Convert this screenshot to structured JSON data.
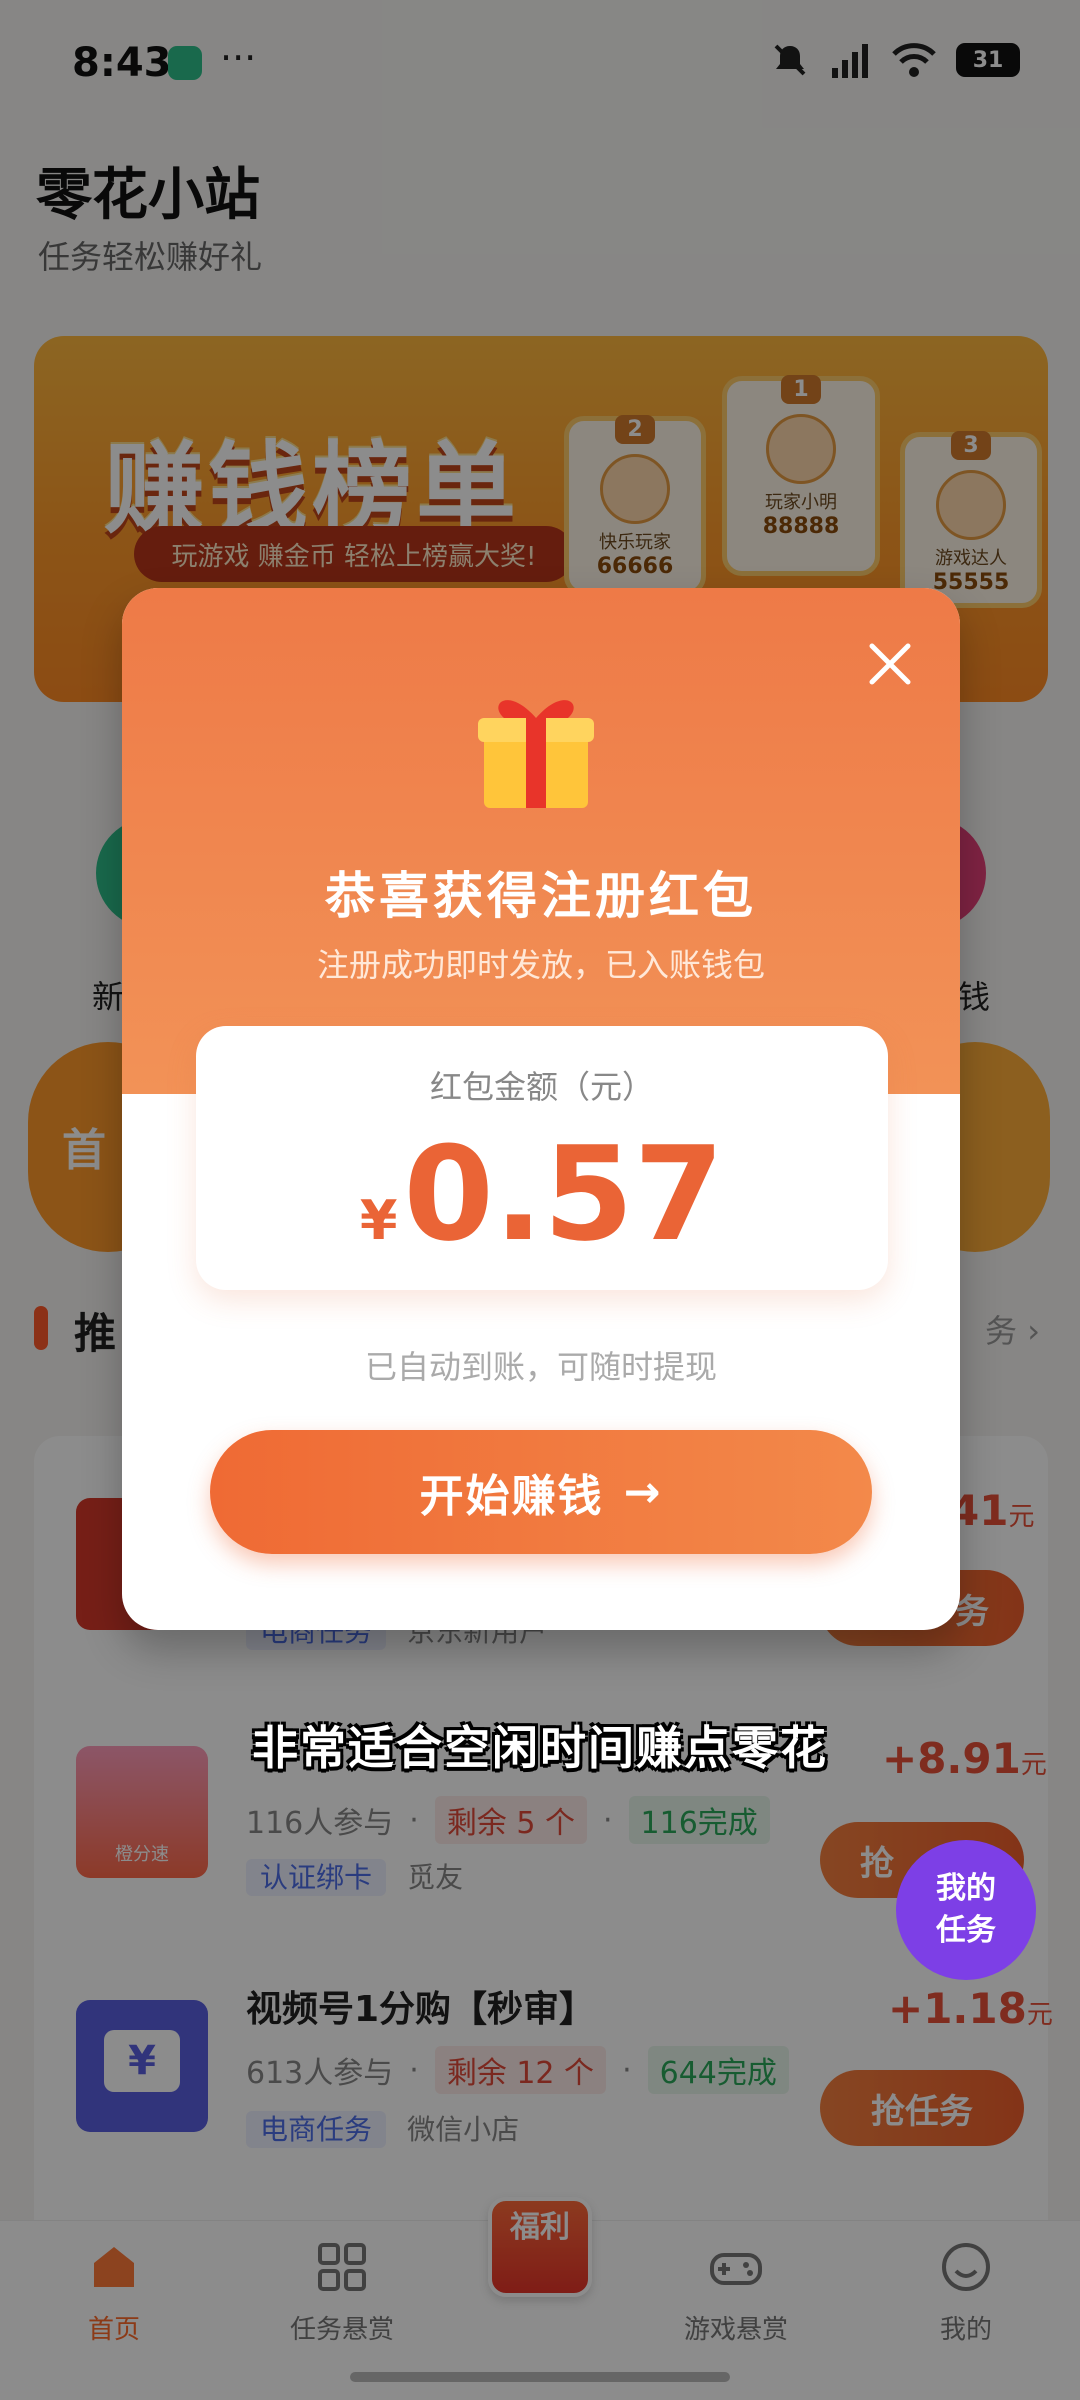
{
  "status_bar": {
    "time": "8:43",
    "more": "···",
    "battery": "31"
  },
  "header": {
    "title": "零花小站",
    "subtitle": "任务轻松赚好礼"
  },
  "banner": {
    "headline": "赚钱榜单",
    "slogan": "玩游戏 赚金币 轻松上榜赢大奖!",
    "leaders": [
      {
        "rank": "2",
        "name": "快乐玩家",
        "score": "66666"
      },
      {
        "rank": "1",
        "name": "玩家小明",
        "score": "88888"
      },
      {
        "rank": "3",
        "name": "游戏达人",
        "score": "55555"
      }
    ]
  },
  "shortcuts": {
    "left_label": "新",
    "right_label": "钱"
  },
  "promo": {
    "left_text": "首"
  },
  "section": {
    "title": "推",
    "more": "务"
  },
  "tasks": [
    {
      "reward": "41",
      "unit": "元",
      "grab": "务",
      "tag": "电商任务",
      "source": "京东新用户"
    },
    {
      "participants": "116人参与",
      "remaining": "剩余 5 个",
      "done": "116完成",
      "tag": "认证绑卡",
      "source": "觅友",
      "reward": "+8.91",
      "unit": "元",
      "grab": "抢",
      "thumb_label": "橙分速"
    },
    {
      "name": "视频号1分购【秒审】",
      "participants": "613人参与",
      "remaining": "剩余 12 个",
      "done": "644完成",
      "tag": "电商任务",
      "source": "微信小店",
      "reward": "+1.18",
      "unit": "元",
      "grab": "抢任务"
    }
  ],
  "floating": {
    "line1": "我的",
    "line2": "任务"
  },
  "tabbar": {
    "items": [
      {
        "label": "首页",
        "icon": "home-icon",
        "active": true
      },
      {
        "label": "任务悬赏",
        "icon": "grid-icon"
      },
      {
        "label": "福利",
        "icon": "gift-badge-icon"
      },
      {
        "label": "游戏悬赏",
        "icon": "gamepad-icon"
      },
      {
        "label": "我的",
        "icon": "smile-icon"
      }
    ]
  },
  "modal": {
    "title": "恭喜获得注册红包",
    "subtitle": "注册成功即时发放，已入账钱包",
    "amount_label": "红包金额（元）",
    "currency": "¥",
    "amount": "0.57",
    "hint": "已自动到账，可随时提现",
    "cta": "开始赚钱",
    "cta_arrow": "→"
  },
  "caption": "非常适合空闲时间赚点零花",
  "colors": {
    "accent": "#ee6a34",
    "brand_orange": "#ff9a2a",
    "overlay": "rgba(0,0,0,0.45)"
  }
}
